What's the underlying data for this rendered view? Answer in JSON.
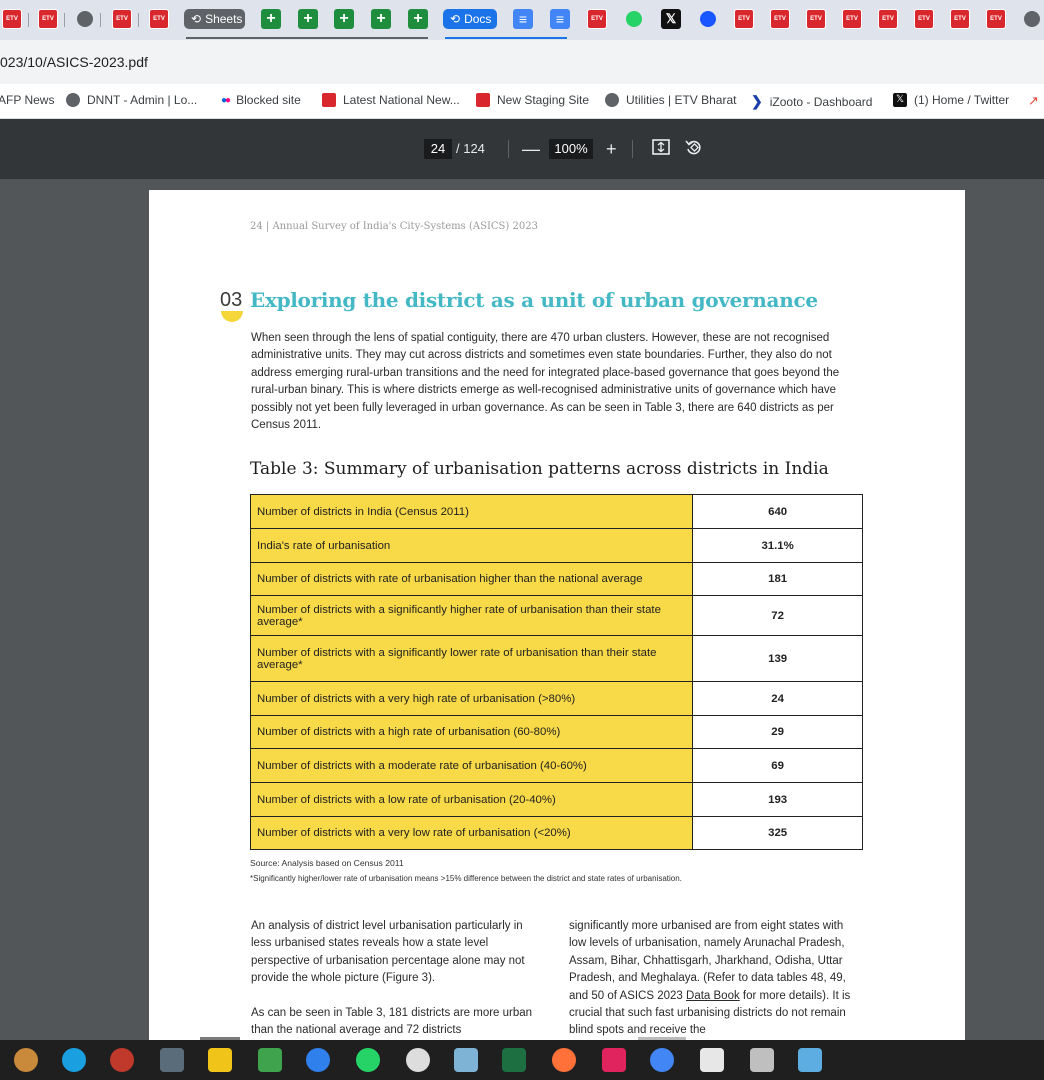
{
  "tabs": {
    "group_sheets": "Sheets",
    "group_docs": "Docs"
  },
  "address": {
    "url": "023/10/ASICS-2023.pdf"
  },
  "bookmarks": [
    {
      "label": "AFP News"
    },
    {
      "label": "DNNT - Admin | Lo..."
    },
    {
      "label": "Blocked site"
    },
    {
      "label": "Latest National New..."
    },
    {
      "label": "New Staging Site"
    },
    {
      "label": "Utilities | ETV Bharat"
    },
    {
      "label": "iZooto - Dashboard"
    },
    {
      "label": "(1) Home / Twitter"
    }
  ],
  "pdf": {
    "page": "24",
    "total": "/ 124",
    "zoom": "100%",
    "minus": "—",
    "plus": "+"
  },
  "doc": {
    "running_head": "24 | Annual Survey of India's City-Systems (ASICS) 2023",
    "section_number": "03",
    "section_title": "Exploring the district as a unit of urban governance",
    "intro": "When seen through the lens of spatial contiguity, there are 470 urban clusters. However, these are not recognised administrative units. They may cut across districts and sometimes even state boundaries. Further, they also do not address emerging rural-urban transitions and the need for integrated place-based governance that goes beyond the rural-urban binary. This is where districts emerge as well-recognised administrative units of governance which have possibly not yet been fully leveraged in urban governance. As can be seen in Table 3, there are 640 districts as per Census 2011.",
    "table_title": "Table 3: Summary of urbanisation patterns across districts in India",
    "table_rows": [
      {
        "label": "Number of districts in India (Census 2011)",
        "value": "640"
      },
      {
        "label": "India's rate of urbanisation",
        "value": "31.1%"
      },
      {
        "label": "Number of districts with rate of urbanisation higher than the national average",
        "value": "181"
      },
      {
        "label": "Number of districts with a significantly higher rate of urbanisation than their state average*",
        "value": "72"
      },
      {
        "label": "Number of districts with a significantly lower rate of urbanisation than their state average*",
        "value": "139"
      },
      {
        "label": "Number of districts with a very high rate of urbanisation (>80%)",
        "value": "24"
      },
      {
        "label": "Number of districts with a high rate of urbanisation (60-80%)",
        "value": "29"
      },
      {
        "label": "Number of districts with a moderate rate of urbanisation (40-60%)",
        "value": "69"
      },
      {
        "label": "Number of districts with a low rate of urbanisation (20-40%)",
        "value": "193"
      },
      {
        "label": "Number of districts with a very low rate of urbanisation (<20%)",
        "value": "325"
      }
    ],
    "source": "Source: Analysis based on Census 2011",
    "footnote": "*Significantly higher/lower rate of urbanisation means >15% difference between the district and state rates of urbanisation.",
    "left_col_p1": "An analysis of district level urbanisation particularly in less urbanised states reveals how a state level perspective of urbanisation percentage alone may not provide the whole picture (Figure 3).",
    "left_col_p2": "As can be seen in Table 3, 181 districts are more urban than the national average and 72 districts",
    "right_col_a": "significantly more urbanised are from eight states with low levels of urbanisation, namely Arunachal Pradesh, Assam, Bihar, Chhattisgarh, Jharkhand, Odisha, Uttar Pradesh, and Meghalaya. (Refer to data tables 48, 49, and 50 of ASICS 2023 ",
    "right_col_link": "Data Book",
    "right_col_b": " for more details). It is crucial that such fast urbanising districts do not remain blind spots and receive the"
  },
  "colors": {
    "accent_teal": "#45b8c6",
    "table_yellow": "#f8d947",
    "etv_red": "#d9272e"
  }
}
